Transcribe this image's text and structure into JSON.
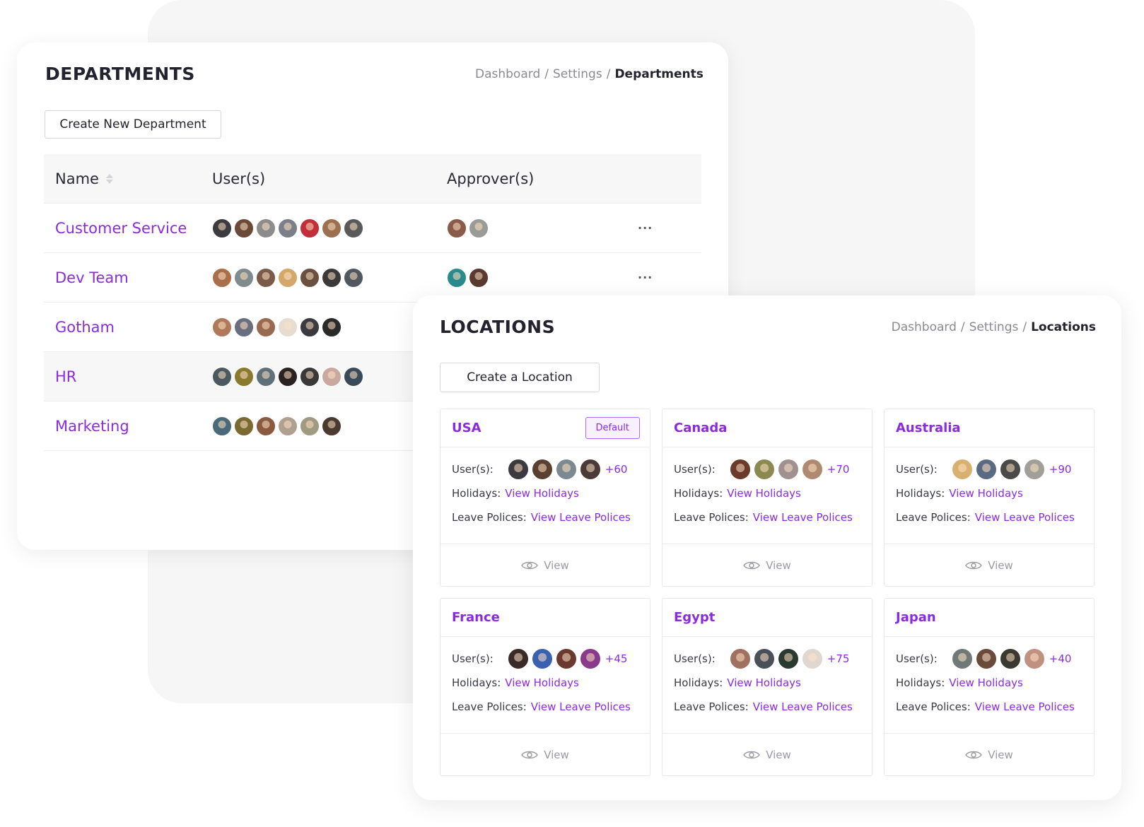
{
  "departments": {
    "title": "DEPARTMENTS",
    "breadcrumb": {
      "item1": "Dashboard",
      "item2": "Settings",
      "current": "Departments"
    },
    "create_button": "Create New Department",
    "columns": {
      "name": "Name",
      "users": "User(s)",
      "approvers": "Approver(s)"
    },
    "more_label": "···",
    "rows": [
      {
        "name": "Customer Service",
        "users": [
          "#3b3b40",
          "#6b4a3a",
          "#8c8c8c",
          "#7a7f88",
          "#c22f3a",
          "#9a7050",
          "#5a5a5a"
        ],
        "approvers": [
          "#8a5a4a",
          "#9a9a96"
        ],
        "has_more": true
      },
      {
        "name": "Dev Team",
        "users": [
          "#a86f4a",
          "#7f8b8c",
          "#7a5a48",
          "#d4a76a",
          "#6b5040",
          "#3a3a3a",
          "#505860"
        ],
        "approvers": [
          "#2a8a8c",
          "#5a3a30"
        ],
        "has_more": true
      },
      {
        "name": "Gotham",
        "users": [
          "#b07a5a",
          "#6a6f80",
          "#9a6a50",
          "#e6dccf",
          "#3a3a40",
          "#2a2a2a"
        ],
        "approvers": [],
        "has_more": false
      },
      {
        "name": "HR",
        "users": [
          "#4a5a60",
          "#8a7a30",
          "#607078",
          "#2a2220",
          "#3a3838",
          "#caa8a0",
          "#3a4a5a"
        ],
        "approvers": [],
        "has_more": false
      },
      {
        "name": "Marketing",
        "users": [
          "#4a6a7a",
          "#7a6a30",
          "#8a5a40",
          "#b0a090",
          "#a09a80",
          "#4a3a30"
        ],
        "approvers": [],
        "has_more": false
      }
    ]
  },
  "locations": {
    "title": "LOCATIONS",
    "breadcrumb": {
      "item1": "Dashboard",
      "item2": "Settings",
      "current": "Locations"
    },
    "create_button": "Create a Location",
    "labels": {
      "users": "User(s):",
      "holidays": "Holidays:",
      "holidays_link": "View Holidays",
      "leave": "Leave Polices:",
      "leave_link": "View Leave Polices",
      "view": "View",
      "default_badge": "Default"
    },
    "cards": [
      {
        "name": "USA",
        "is_default": true,
        "count": "+60",
        "avatars": [
          "#3a3a40",
          "#5a4030",
          "#7a8a90",
          "#4a3a38"
        ]
      },
      {
        "name": "Canada",
        "is_default": false,
        "count": "+70",
        "avatars": [
          "#6a3a2a",
          "#8a8a50",
          "#a09090",
          "#b08a70"
        ]
      },
      {
        "name": "Australia",
        "is_default": false,
        "count": "+90",
        "avatars": [
          "#d8b070",
          "#5a6a80",
          "#4a4a48",
          "#a0a098"
        ]
      },
      {
        "name": "France",
        "is_default": false,
        "count": "+45",
        "avatars": [
          "#3a2a28",
          "#3a60b0",
          "#6a3a30",
          "#8a3a8a"
        ]
      },
      {
        "name": "Egypt",
        "is_default": false,
        "count": "+75",
        "avatars": [
          "#a07060",
          "#4a5058",
          "#2a3a30",
          "#e0d8d0"
        ]
      },
      {
        "name": "Japan",
        "is_default": false,
        "count": "+40",
        "avatars": [
          "#707878",
          "#6a4a3a",
          "#3a3a30",
          "#c09080"
        ]
      }
    ]
  },
  "colors": {
    "accent": "#8a2be2",
    "muted": "#8a8a92",
    "background_shape": "#f6f6f7"
  }
}
